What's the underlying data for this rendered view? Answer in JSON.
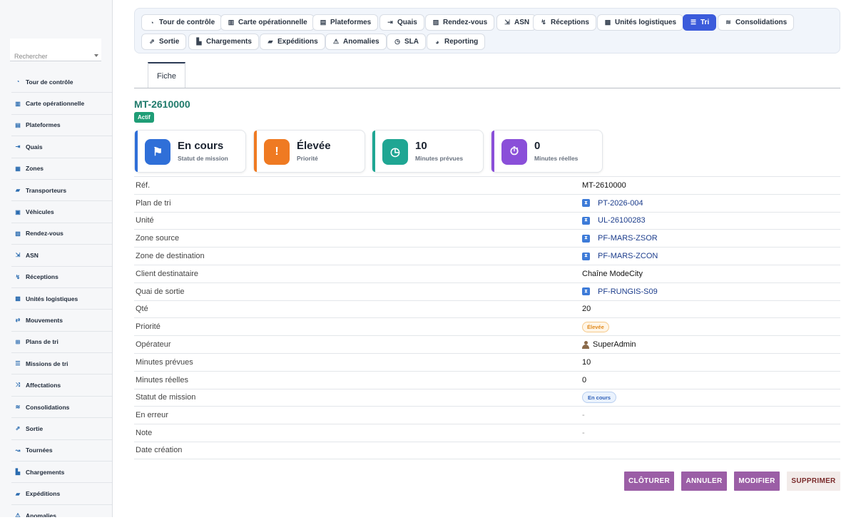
{
  "sidebar": {
    "search_placeholder": "Rechercher",
    "items": [
      {
        "label": "Tour de contrôle",
        "icon": "gauge-icon",
        "glyph": "◔"
      },
      {
        "label": "Carte opérationnelle",
        "icon": "map-icon",
        "glyph": "▥"
      },
      {
        "label": "Plateformes",
        "icon": "warehouse-icon",
        "glyph": "▤"
      },
      {
        "label": "Quais",
        "icon": "dock-icon",
        "glyph": "⇥"
      },
      {
        "label": "Zones",
        "icon": "grid-icon",
        "glyph": "▦"
      },
      {
        "label": "Transporteurs",
        "icon": "truck-icon",
        "glyph": "▰"
      },
      {
        "label": "Véhicules",
        "icon": "bus-icon",
        "glyph": "▣"
      },
      {
        "label": "Rendez-vous",
        "icon": "calendar-icon",
        "glyph": "▨"
      },
      {
        "label": "ASN",
        "icon": "file-import-icon",
        "glyph": "⇲"
      },
      {
        "label": "Réceptions",
        "icon": "dolly-icon",
        "glyph": "↯"
      },
      {
        "label": "Unités logistiques",
        "icon": "pallet-icon",
        "glyph": "▩"
      },
      {
        "label": "Mouvements",
        "icon": "arrows-icon",
        "glyph": "⇄"
      },
      {
        "label": "Plans de tri",
        "icon": "sitemap-icon",
        "glyph": "⊞"
      },
      {
        "label": "Missions de tri",
        "icon": "list-icon",
        "glyph": "☰"
      },
      {
        "label": "Affectations",
        "icon": "shuffle-icon",
        "glyph": "⤨"
      },
      {
        "label": "Consolidations",
        "icon": "layers-icon",
        "glyph": "≋"
      },
      {
        "label": "Sortie",
        "icon": "export-icon",
        "glyph": "⇗"
      },
      {
        "label": "Tournées",
        "icon": "route-icon",
        "glyph": "↝"
      },
      {
        "label": "Chargements",
        "icon": "loading-icon",
        "glyph": "▙"
      },
      {
        "label": "Expéditions",
        "icon": "shipping-icon",
        "glyph": "▰"
      },
      {
        "label": "Anomalies",
        "icon": "warning-icon",
        "glyph": "⚠"
      }
    ]
  },
  "topnav": {
    "tabs": [
      {
        "label": "Tour de contrôle",
        "icon": "gauge-icon",
        "glyph": "◔"
      },
      {
        "label": "Carte opérationnelle",
        "icon": "map-icon",
        "glyph": "▥"
      },
      {
        "label": "Plateformes",
        "icon": "warehouse-icon",
        "glyph": "▤"
      },
      {
        "label": "Quais",
        "icon": "dock-icon",
        "glyph": "⇥"
      },
      {
        "label": "Rendez-vous",
        "icon": "calendar-icon",
        "glyph": "▨"
      },
      {
        "label": "ASN",
        "icon": "file-import-icon",
        "glyph": "⇲"
      },
      {
        "label": "Réceptions",
        "icon": "dolly-icon",
        "glyph": "↯"
      },
      {
        "label": "Unités logistiques",
        "icon": "pallet-icon",
        "glyph": "▩"
      },
      {
        "label": "Tri",
        "icon": "list-icon",
        "glyph": "☰",
        "active": true
      },
      {
        "label": "Consolidations",
        "icon": "layers-icon",
        "glyph": "≋"
      },
      {
        "label": "Sortie",
        "icon": "export-icon",
        "glyph": "⇗"
      },
      {
        "label": "Chargements",
        "icon": "loading-icon",
        "glyph": "▙"
      },
      {
        "label": "Expéditions",
        "icon": "shipping-icon",
        "glyph": "▰"
      },
      {
        "label": "Anomalies",
        "icon": "warning-icon",
        "glyph": "⚠"
      },
      {
        "label": "SLA",
        "icon": "stopwatch-icon",
        "glyph": "◷"
      },
      {
        "label": "Reporting",
        "icon": "chart-pie-icon",
        "glyph": "◕"
      }
    ]
  },
  "record": {
    "subtab": "Fiche",
    "title": "MT-2610000",
    "state_badge": "Actif"
  },
  "cards": [
    {
      "value": "En cours",
      "label": "Statut de mission",
      "icon": "flag-icon",
      "glyph": "⚑",
      "color": "#2f6fd8"
    },
    {
      "value": "Élevée",
      "label": "Priorité",
      "icon": "exclamation-icon",
      "glyph": "!",
      "color": "#ef7a22"
    },
    {
      "value": "10",
      "label": "Minutes prévues",
      "icon": "clock-icon",
      "glyph": "◷",
      "color": "#1fa693"
    },
    {
      "value": "0",
      "label": "Minutes réelles",
      "icon": "stopwatch-icon",
      "glyph": "⏱",
      "color": "#8a4fd9"
    }
  ],
  "fields": [
    {
      "key": "Réf.",
      "value": "MT-2610000",
      "type": "text"
    },
    {
      "key": "Plan de tri",
      "value": "PT-2026-004",
      "type": "link"
    },
    {
      "key": "Unité",
      "value": "UL-26100283",
      "type": "link"
    },
    {
      "key": "Zone source",
      "value": "PF-MARS-ZSOR",
      "type": "link"
    },
    {
      "key": "Zone de destination",
      "value": "PF-MARS-ZCON",
      "type": "link"
    },
    {
      "key": "Client destinataire",
      "value": "Chaîne ModeCity",
      "type": "text"
    },
    {
      "key": "Quai de sortie",
      "value": "PF-RUNGIS-S09",
      "type": "link"
    },
    {
      "key": "Qté",
      "value": "20",
      "type": "text"
    },
    {
      "key": "Priorité",
      "value": "Élevée",
      "type": "badge-prio"
    },
    {
      "key": "Opérateur",
      "value": "SuperAdmin",
      "type": "user"
    },
    {
      "key": "Minutes prévues",
      "value": "10",
      "type": "text"
    },
    {
      "key": "Minutes réelles",
      "value": "0",
      "type": "text"
    },
    {
      "key": "Statut de mission",
      "value": "En cours",
      "type": "badge-status"
    },
    {
      "key": "En erreur",
      "value": "-",
      "type": "dash"
    },
    {
      "key": "Note",
      "value": "-",
      "type": "dash"
    },
    {
      "key": "Date création",
      "value": "",
      "type": "text"
    }
  ],
  "actions": {
    "close": "CLÔTURER",
    "cancel": "ANNULER",
    "edit": "MODIFIER",
    "delete": "SUPPRIMER"
  }
}
